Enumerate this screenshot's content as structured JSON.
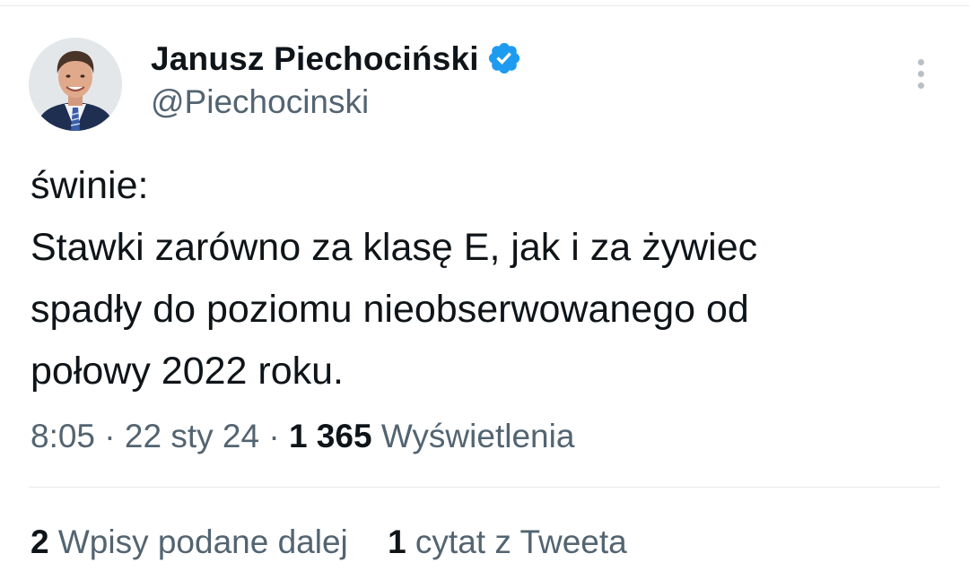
{
  "author": {
    "display_name": "Janusz Piechociński",
    "handle": "@Piechocinski",
    "verified_icon": "verified-badge-icon",
    "avatar_icon": "profile-photo"
  },
  "colors": {
    "text_primary": "#0f1419",
    "text_secondary": "#536471",
    "verified_blue": "#1d9bf0",
    "divider": "#e6e9ec"
  },
  "tweet": {
    "lines": [
      "świnie:",
      "Stawki zarówno za klasę E, jak i za żywiec",
      "spadły do poziomu nieobserwowanego od",
      "połowy 2022 roku."
    ]
  },
  "meta": {
    "time": "8:05",
    "separator": "·",
    "date": "22 sty 24",
    "views_count": "1 365",
    "views_label": "Wyświetlenia"
  },
  "stats": {
    "reposts_count": "2",
    "reposts_label": "Wpisy podane dalej",
    "quotes_count": "1",
    "quotes_label": "cytat z Tweeta"
  }
}
